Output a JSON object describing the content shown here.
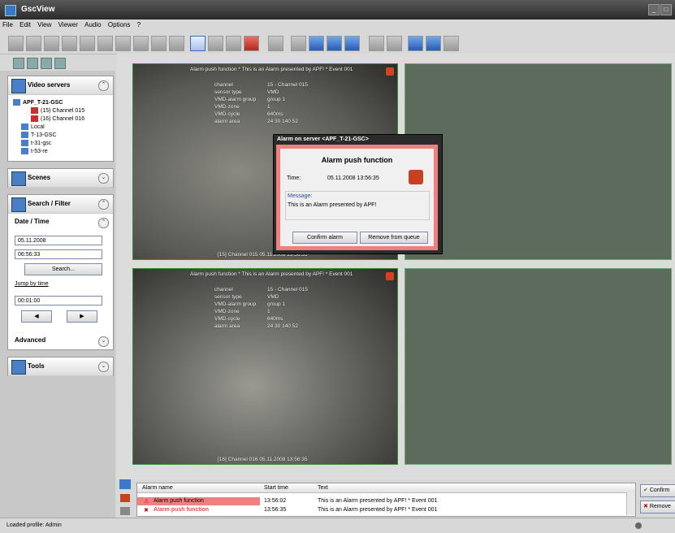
{
  "window": {
    "title": "GscView"
  },
  "menu": [
    "File",
    "Edit",
    "View",
    "Viewer",
    "Audio",
    "Options",
    "?"
  ],
  "sidebar": {
    "video_servers": {
      "title": "Video servers",
      "server": "APF_T-21-GSC",
      "channels": [
        "(15) Channel 015",
        "(16) Channel 016"
      ],
      "other_servers": [
        "Local",
        "T-13-GSC",
        "t-31-gsc",
        "t-53-re"
      ]
    },
    "scenes": {
      "title": "Scenes"
    },
    "search": {
      "title": "Search / Filter",
      "date_time_label": "Date / Time",
      "date": "05.11.2008",
      "time": "06:56:33",
      "search_button": "Search...",
      "jump_label": "Jump by time",
      "jump_value": "00:01:00",
      "advanced_label": "Advanced"
    },
    "tools": {
      "title": "Tools"
    }
  },
  "cameras": [
    {
      "overlay_title": "Alarm push function * This is an Alarm presented by APF! * Event 001",
      "rows": [
        [
          "channel",
          "15 - Channel 015"
        ],
        [
          "sensor type",
          "VMD"
        ],
        [
          "VMD-alarm group",
          "group 1"
        ],
        [
          "VMD-zone",
          "1"
        ],
        [
          "VMD-cycle",
          "640ms"
        ],
        [
          "alarm area",
          "24 30 140 52"
        ]
      ],
      "caption": "[15] Channel 015  05.11.2008 13:56:35"
    },
    {
      "overlay_title": "Alarm push function * This is an Alarm presented by APF! * Event 001",
      "rows": [
        [
          "channel",
          "15 - Channel 015"
        ],
        [
          "sensor type",
          "VMD"
        ],
        [
          "VMD-alarm group",
          "group 1"
        ],
        [
          "VMD-zone",
          "1"
        ],
        [
          "VMD-cycle",
          "640ms"
        ],
        [
          "alarm area",
          "24 30 140 52"
        ]
      ],
      "caption": "[16] Channel 016  05.11.2008 13:56:35"
    }
  ],
  "dialog": {
    "window_title": "Alarm on server <APF_T-21-GSC>",
    "heading": "Alarm push function",
    "time_label": "Time:",
    "time_value": "05.11.2008 13:56:35",
    "message_label": "Message:",
    "message": "This is an Alarm presented by APF!",
    "confirm_button": "Confirm alarm",
    "remove_button": "Remove from queue"
  },
  "alarm_list": {
    "columns": [
      "Alarm name",
      "Start time",
      "Text"
    ],
    "rows": [
      {
        "name": "Alarm push function",
        "start": "13:56:02",
        "text": "This is an Alarm presented by APF!  * Event 001"
      },
      {
        "name": "Alarm push function",
        "start": "13:56:35",
        "text": "This is an Alarm presented by APF!  * Event 001"
      }
    ],
    "confirm_button": "Confirm",
    "remove_button": "Remove"
  },
  "status": {
    "text": "Loaded profile: Admin"
  },
  "colors": {
    "alarm_red": "#f08080",
    "highlight_row": "#f08080",
    "tile_border": "#3a8a3a"
  }
}
